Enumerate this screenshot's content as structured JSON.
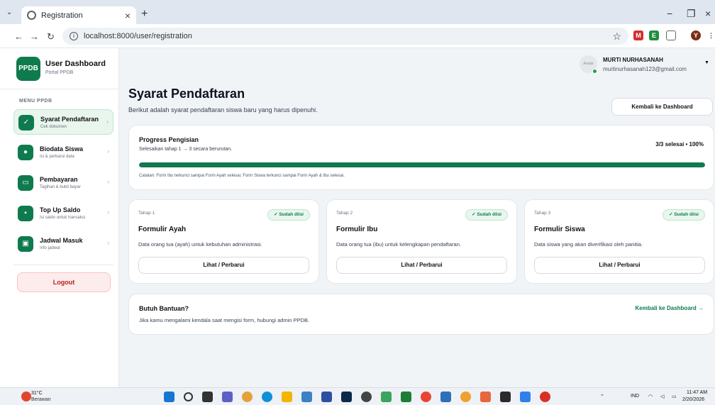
{
  "browser": {
    "tab_title": "Registration",
    "url": "localhost:8000/user/registration"
  },
  "sidebar": {
    "logo_text": "PPDB",
    "brand_title": "User Dashboard",
    "brand_sub": "Portal PPDB",
    "menu_header": "MENU PPDB",
    "items": [
      {
        "title": "Syarat Pendaftaran",
        "sub": "Cek dokumen",
        "icon": "check-icon",
        "glyph": "✓"
      },
      {
        "title": "Biodata Siswa",
        "sub": "Isi & perbarui data",
        "icon": "user-icon",
        "glyph": "●"
      },
      {
        "title": "Pembayaran",
        "sub": "Tagihan & bukti bayar",
        "icon": "card-icon",
        "glyph": "▭"
      },
      {
        "title": "Top Up Saldo",
        "sub": "Isi saldo untuk transaksi",
        "icon": "wallet-icon",
        "glyph": "▪"
      },
      {
        "title": "Jadwal Masuk",
        "sub": "Info jadwal",
        "icon": "calendar-icon",
        "glyph": "▣"
      }
    ],
    "logout": "Logout"
  },
  "user": {
    "avatar_alt": "Avatar",
    "name": "MURTI NURHASANAH",
    "email": "murtinurhasanah123@gmail.com"
  },
  "header": {
    "title": "Syarat Pendaftaran",
    "subtitle": "Berikut adalah syarat pendaftaran siswa baru yang harus dipenuhi.",
    "back_button": "Kembali ke Dashboard"
  },
  "progress": {
    "title": "Progress Pengisian",
    "subtitle": "Selesaikan tahap 1 → 3 secara berurutan.",
    "status": "3/3 selesai • 100%",
    "percent": 100,
    "note": "Catatan: Form Ibu terkunci sampai Form Ayah selesai. Form Siswa terkunci sampai Form Ayah & Ibu selesai."
  },
  "steps": [
    {
      "tag": "Tahap 1",
      "badge": "✓ Sudah diisi",
      "title": "Formulir Ayah",
      "desc": "Data orang tua (ayah) untuk kebutuhan administrasi.",
      "button": "Lihat / Perbarui"
    },
    {
      "tag": "Tahap 2",
      "badge": "✓ Sudah diisi",
      "title": "Formulir Ibu",
      "desc": "Data orang tua (ibu) untuk kelengkapan pendaftaran.",
      "button": "Lihat / Perbarui"
    },
    {
      "tag": "Tahap 3",
      "badge": "✓ Sudah diisi",
      "title": "Formulir Siswa",
      "desc": "Data siswa yang akan diverifikasi oleh panitia.",
      "button": "Lihat / Perbarui"
    }
  ],
  "help": {
    "title": "Butuh Bantuan?",
    "subtitle": "Jika kamu mengalami kendala saat mengisi form, hubungi admin PPDB.",
    "link": "Kembali ke Dashboard →"
  },
  "taskbar": {
    "temp": "31°C",
    "weather": "Berawan",
    "lang": "IND",
    "time": "11:47 AM",
    "date": "2/20/2026"
  },
  "colors": {
    "primary": "#0f7a4d",
    "danger": "#b91c1c",
    "background": "#f1f4f7"
  }
}
